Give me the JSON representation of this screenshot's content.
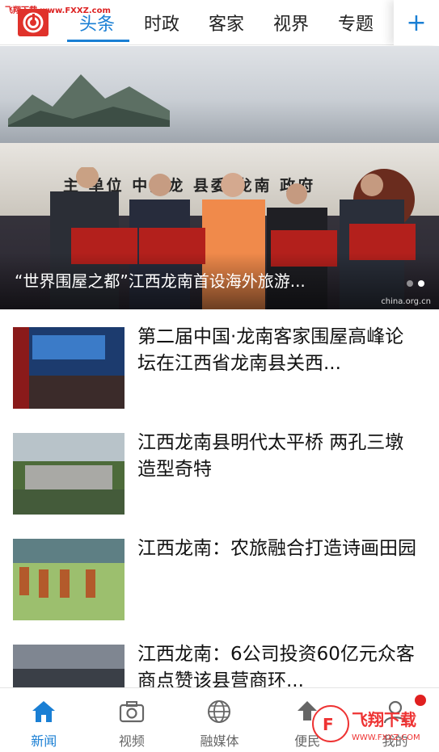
{
  "watermark_top": "飞翔下载 www.FXXZ.com",
  "colors": {
    "accent": "#1a7fd4",
    "brand": "#e0322b"
  },
  "nav": {
    "tabs": [
      {
        "label": "头条",
        "active": true
      },
      {
        "label": "时政"
      },
      {
        "label": "客家"
      },
      {
        "label": "视界"
      },
      {
        "label": "专题"
      }
    ],
    "plus_icon": "plus-icon"
  },
  "hero": {
    "stage_text": "主 单位  中共龙 县委  龙南 政府",
    "caption": "“世界围屋之都”江西龙南首设海外旅游...",
    "image_watermark": "china.org.cn",
    "slides": 2,
    "active_slide": 2
  },
  "news": [
    {
      "title": "第二届中国·龙南客家围屋高峰论坛在江西省龙南县关西..."
    },
    {
      "title": "江西龙南县明代太平桥 两孔三墩造型奇特"
    },
    {
      "title": "江西龙南：农旅融合打造诗画田园"
    },
    {
      "title": "江西龙南：6公司投资60亿元众客商点赞该县营商环..."
    }
  ],
  "bottom_nav": [
    {
      "label": "新闻",
      "icon": "home-icon",
      "active": true
    },
    {
      "label": "视频",
      "icon": "camera-icon"
    },
    {
      "label": "融媒体",
      "icon": "globe-icon"
    },
    {
      "label": "便民",
      "icon": "upload-icon"
    },
    {
      "label": "我的",
      "icon": "user-icon"
    }
  ],
  "watermark_bottom": "飞翔下载 WWW.FXXZ.COM"
}
